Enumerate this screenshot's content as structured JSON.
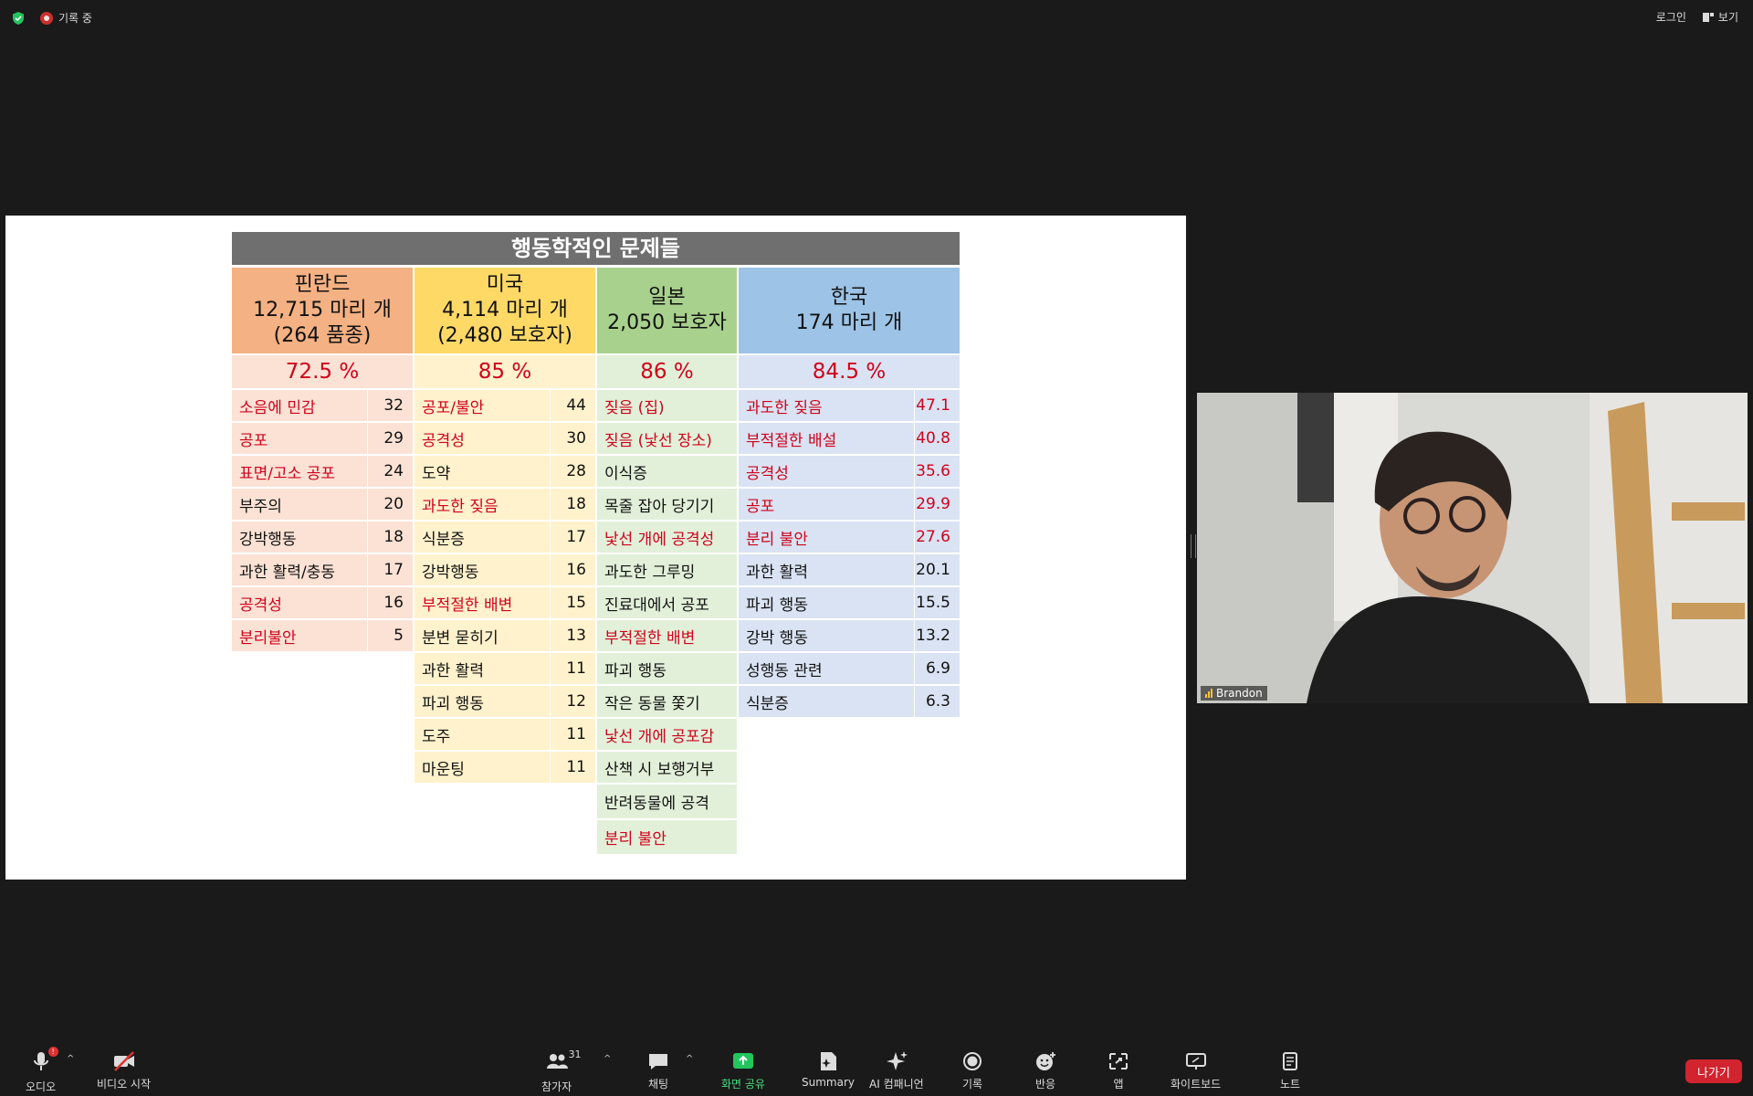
{
  "topbar": {
    "recording_label": "기록 중",
    "login_label": "로그인",
    "view_label": "보기"
  },
  "slide": {
    "title": "행동학적인 문제들",
    "columns": [
      {
        "name": "핀란드",
        "line2": "12,715 마리 개",
        "line3": "(264 품종)",
        "pct": "72.5 %",
        "rows": [
          {
            "label": "소음에 민감",
            "value": "32",
            "red": true
          },
          {
            "label": "공포",
            "value": "29",
            "red": true
          },
          {
            "label": "표면/고소 공포",
            "value": "24",
            "red": true
          },
          {
            "label": "부주의",
            "value": "20",
            "red": false
          },
          {
            "label": "강박행동",
            "value": "18",
            "red": false
          },
          {
            "label": "과한 활력/충동",
            "value": "17",
            "red": false
          },
          {
            "label": "공격성",
            "value": "16",
            "red": true
          },
          {
            "label": "분리불안",
            "value": "5",
            "red": true
          }
        ]
      },
      {
        "name": "미국",
        "line2": "4,114 마리 개",
        "line3": "(2,480 보호자)",
        "pct": "85 %",
        "rows": [
          {
            "label": "공포/불안",
            "value": "44",
            "red": true
          },
          {
            "label": "공격성",
            "value": "30",
            "red": true
          },
          {
            "label": "도약",
            "value": "28",
            "red": false
          },
          {
            "label": "과도한 짖음",
            "value": "18",
            "red": true
          },
          {
            "label": "식분증",
            "value": "17",
            "red": false
          },
          {
            "label": "강박행동",
            "value": "16",
            "red": false
          },
          {
            "label": "부적절한 배변",
            "value": "15",
            "red": true
          },
          {
            "label": "분변 묻히기",
            "value": "13",
            "red": false
          },
          {
            "label": "과한 활력",
            "value": "11",
            "red": false
          },
          {
            "label": "파괴 행동",
            "value": "12",
            "red": false
          },
          {
            "label": "도주",
            "value": "11",
            "red": false
          },
          {
            "label": "마운팅",
            "value": "11",
            "red": false
          }
        ]
      },
      {
        "name": "일본",
        "line2": "2,050 보호자",
        "line3": "",
        "pct": "86 %",
        "rows": [
          {
            "label": "짖음 (집)",
            "red": true
          },
          {
            "label": "짖음 (낯선 장소)",
            "red": true
          },
          {
            "label": "이식증",
            "red": false
          },
          {
            "label": "목줄 잡아 당기기",
            "red": false
          },
          {
            "label": "낯선 개에 공격성",
            "red": true
          },
          {
            "label": "과도한 그루밍",
            "red": false
          },
          {
            "label": "진료대에서 공포",
            "red": false
          },
          {
            "label": "부적절한 배변",
            "red": true
          },
          {
            "label": "파괴 행동",
            "red": false
          },
          {
            "label": "작은 동물 쫓기",
            "red": false
          },
          {
            "label": "낯선 개에 공포감",
            "red": true
          },
          {
            "label": "산책 시 보행거부",
            "red": false
          },
          {
            "label": "반려동물에 공격",
            "red": false
          },
          {
            "label": "분리 불안",
            "red": true
          }
        ]
      },
      {
        "name": "한국",
        "line2": "174 마리 개",
        "line3": "",
        "pct": "84.5 %",
        "rows": [
          {
            "label": "과도한 짖음",
            "value": "47.1",
            "red": true
          },
          {
            "label": "부적절한 배설",
            "value": "40.8",
            "red": true
          },
          {
            "label": "공격성",
            "value": "35.6",
            "red": true
          },
          {
            "label": "공포",
            "value": "29.9",
            "red": true
          },
          {
            "label": "분리 불안",
            "value": "27.6",
            "red": true
          },
          {
            "label": "과한 활력",
            "value": "20.1",
            "red": false
          },
          {
            "label": "파괴 행동",
            "value": "15.5",
            "red": false
          },
          {
            "label": "강박 행동",
            "value": "13.2",
            "red": false
          },
          {
            "label": "성행동 관련",
            "value": "6.9",
            "red": false
          },
          {
            "label": "식분증",
            "value": "6.3",
            "red": false
          }
        ]
      }
    ]
  },
  "video": {
    "participant_name": "Brandon"
  },
  "toolbar": {
    "audio": "오디오",
    "video": "비디오 시작",
    "participants": "참가자",
    "participants_count": "31",
    "chat": "채팅",
    "share": "화면 공유",
    "summary": "Summary",
    "ai": "AI 컴패니언",
    "record": "기록",
    "reactions": "반응",
    "apps": "앱",
    "whiteboard": "화이트보드",
    "notes": "노트",
    "leave": "나가기"
  },
  "colors": {
    "finland_head": "#f4b183",
    "finland_body": "#fbe2d5",
    "usa_head": "#ffd966",
    "usa_body": "#fff2cc",
    "japan_head": "#a9d18e",
    "japan_body": "#e2f0d9",
    "korea_head": "#9dc3e6",
    "korea_body": "#dae3f3",
    "highlight_red": "#d0021b",
    "share_green": "#22c55e",
    "leave_red": "#d1242f"
  }
}
